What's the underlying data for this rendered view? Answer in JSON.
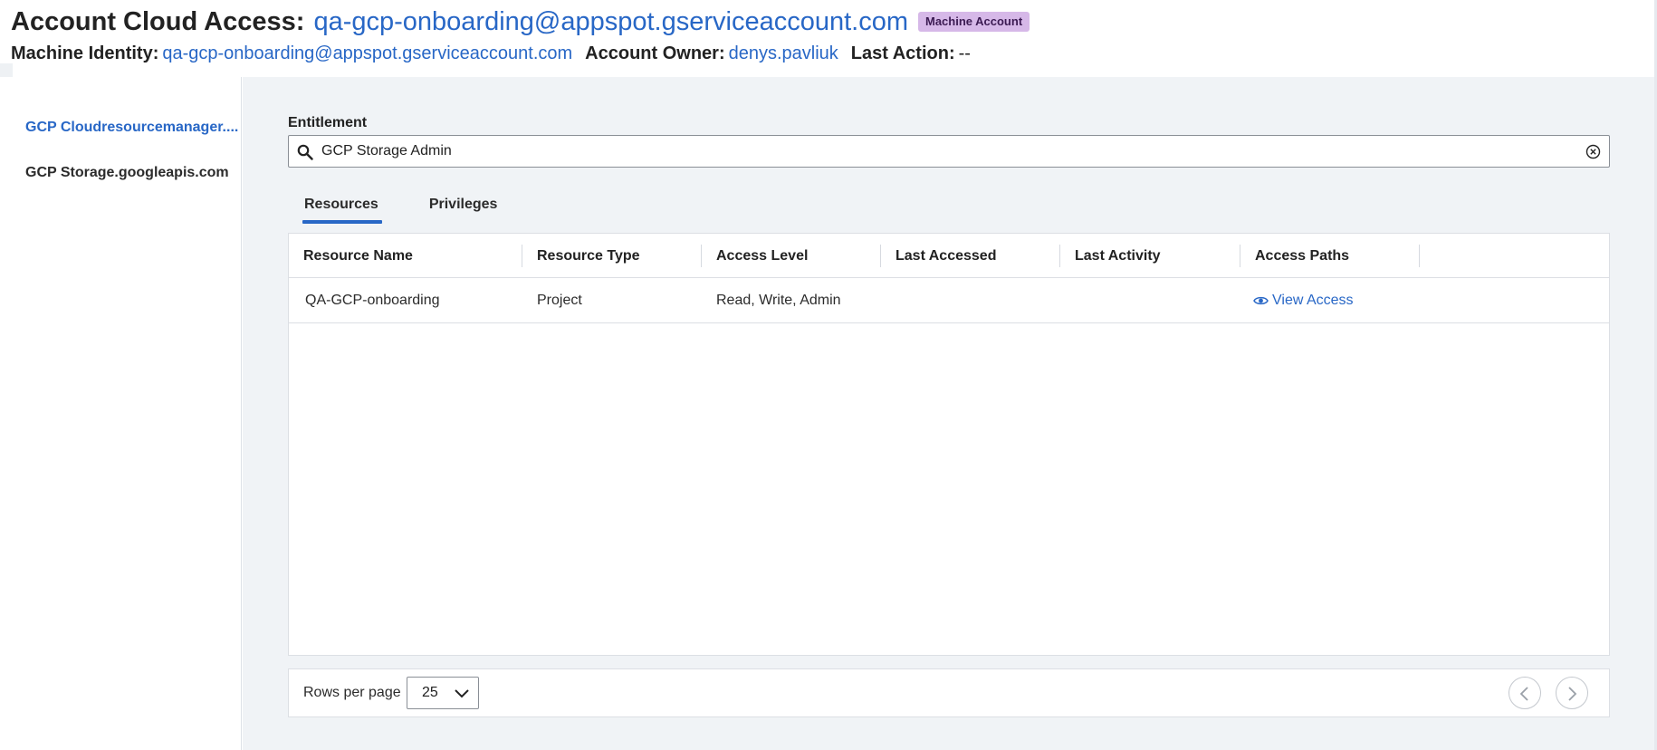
{
  "header": {
    "title_label": "Account Cloud Access:",
    "title_account": "qa-gcp-onboarding@appspot.gserviceaccount.com",
    "badge": "Machine Account",
    "machine_identity_label": "Machine Identity:",
    "machine_identity_value": "qa-gcp-onboarding@appspot.gserviceaccount.com",
    "account_owner_label": "Account Owner:",
    "account_owner_value": "denys.pavliuk",
    "last_action_label": "Last Action:",
    "last_action_value": "--"
  },
  "sidebar": {
    "items": [
      {
        "label": "GCP Cloudresourcemanager....",
        "active": true
      },
      {
        "label": "GCP Storage.googleapis.com",
        "active": false
      }
    ]
  },
  "entitlement": {
    "label": "Entitlement",
    "value": "GCP Storage Admin"
  },
  "tabs": [
    {
      "label": "Resources",
      "active": true
    },
    {
      "label": "Privileges",
      "active": false
    }
  ],
  "table": {
    "columns": [
      "Resource Name",
      "Resource Type",
      "Access Level",
      "Last Accessed",
      "Last Activity",
      "Access Paths"
    ],
    "rows": [
      {
        "resource_name": "QA-GCP-onboarding",
        "resource_type": "Project",
        "access_level": "Read, Write, Admin",
        "last_accessed": "",
        "last_activity": "",
        "access_paths": "View Access"
      }
    ]
  },
  "pagination": {
    "rows_per_page_label": "Rows per page",
    "rows_per_page_value": "25"
  },
  "colors": {
    "accent": "#2867c6",
    "badge_bg": "#d6b8e8",
    "main_bg": "#f0f3f6"
  },
  "icons": [
    "search-icon",
    "clear-circle-icon",
    "eye-icon",
    "chevron-down-icon",
    "chevron-left-icon",
    "chevron-right-icon"
  ]
}
